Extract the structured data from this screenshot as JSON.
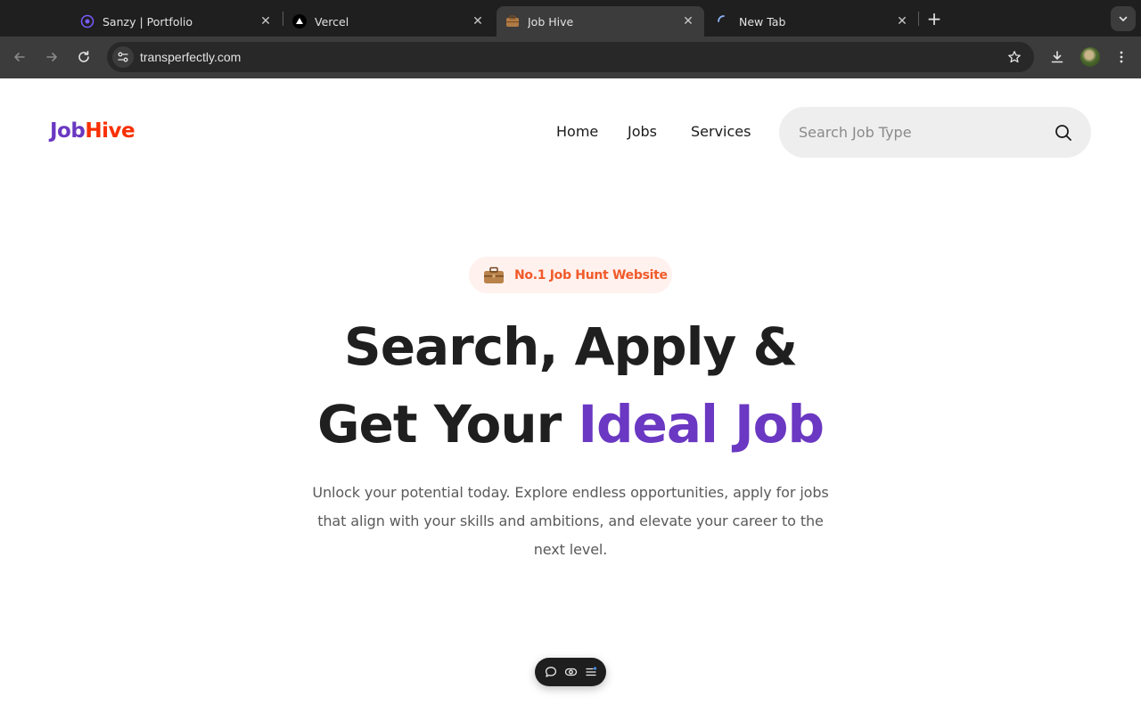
{
  "browser": {
    "tabs": [
      {
        "label": "Sanzy | Portfolio",
        "favicon": "portfolio-favicon-icon",
        "active": false
      },
      {
        "label": "Vercel",
        "favicon": "vercel-triangle-icon",
        "active": false
      },
      {
        "label": "Job Hive",
        "favicon": "briefcase-icon",
        "active": true
      },
      {
        "label": "New Tab",
        "favicon": "loading-spinner-icon",
        "active": false
      }
    ],
    "url": "transperfectly.com"
  },
  "site": {
    "logo": {
      "part1": "Job",
      "part2": "Hive"
    },
    "nav": {
      "home": "Home",
      "jobs": "Jobs",
      "services": "Services"
    },
    "search": {
      "placeholder": "Search Job Type",
      "value": ""
    },
    "badge": {
      "text": "No.1 Job Hunt Website",
      "icon": "briefcase-icon"
    },
    "hero": {
      "line1": "Search, Apply &",
      "line2_plain": "Get Your ",
      "line2_accent": "Ideal Job"
    },
    "lead": "Unlock your potential today. Explore endless opportunities, apply for jobs that align with your skills and ambitions, and elevate your career to the next level."
  },
  "floating_toolbar": {
    "icons": [
      "comment-icon",
      "eye-icon",
      "menu-icon"
    ]
  },
  "colors": {
    "brand_purple": "#6a38c2",
    "brand_orange": "#f83002",
    "badge_text": "#f15a2a",
    "badge_bg": "#fff1ee"
  }
}
